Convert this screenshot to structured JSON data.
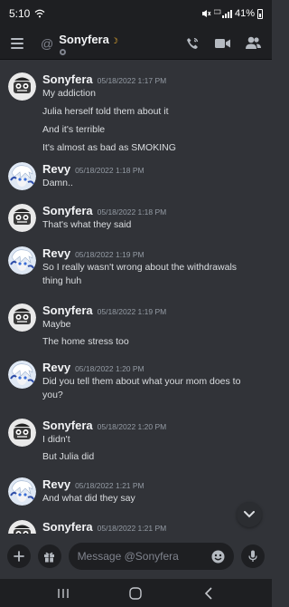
{
  "status": {
    "time": "5:10",
    "battery": "41%"
  },
  "header": {
    "at": "@",
    "name": "Sonyfera",
    "status_emoji": "☽"
  },
  "messages": [
    {
      "author": "Sonyfera",
      "timestamp": "05/18/2022 1:17 PM",
      "avatar": "sonyfera-avatar",
      "lines": [
        "My addiction",
        "Julia herself told them about it",
        "And it's terrible",
        "It's almost as bad as SMOKING"
      ]
    },
    {
      "author": "Revy",
      "timestamp": "05/18/2022 1:18 PM",
      "avatar": "revy-avatar",
      "lines": [
        "Damn.."
      ]
    },
    {
      "author": "Sonyfera",
      "timestamp": "05/18/2022 1:18 PM",
      "avatar": "sonyfera-avatar",
      "lines": [
        "That's what they said"
      ]
    },
    {
      "author": "Revy",
      "timestamp": "05/18/2022 1:19 PM",
      "avatar": "revy-avatar",
      "lines": [
        "So I really wasn't wrong about the withdrawals",
        "thing huh"
      ]
    },
    {
      "author": "Sonyfera",
      "timestamp": "05/18/2022 1:19 PM",
      "avatar": "sonyfera-avatar",
      "lines": [
        "Maybe",
        "The home stress too"
      ]
    },
    {
      "author": "Revy",
      "timestamp": "05/18/2022 1:20 PM",
      "avatar": "revy-avatar",
      "lines": [
        "Did you tell them about what your mom does to",
        "you?"
      ]
    },
    {
      "author": "Sonyfera",
      "timestamp": "05/18/2022 1:20 PM",
      "avatar": "sonyfera-avatar",
      "lines": [
        "I didn't",
        "But Julia did"
      ]
    },
    {
      "author": "Revy",
      "timestamp": "05/18/2022 1:21 PM",
      "avatar": "revy-avatar",
      "lines": [
        "And what did they say"
      ]
    },
    {
      "author": "Sonyfera",
      "timestamp": "05/18/2022 1:21 PM",
      "avatar": "sonyfera-avatar",
      "lines": []
    }
  ],
  "composer": {
    "placeholder": "Message @Sonyfera"
  },
  "colors": {
    "background": "#313338",
    "bars": "#1e1f22",
    "idle": "#f0b232"
  }
}
